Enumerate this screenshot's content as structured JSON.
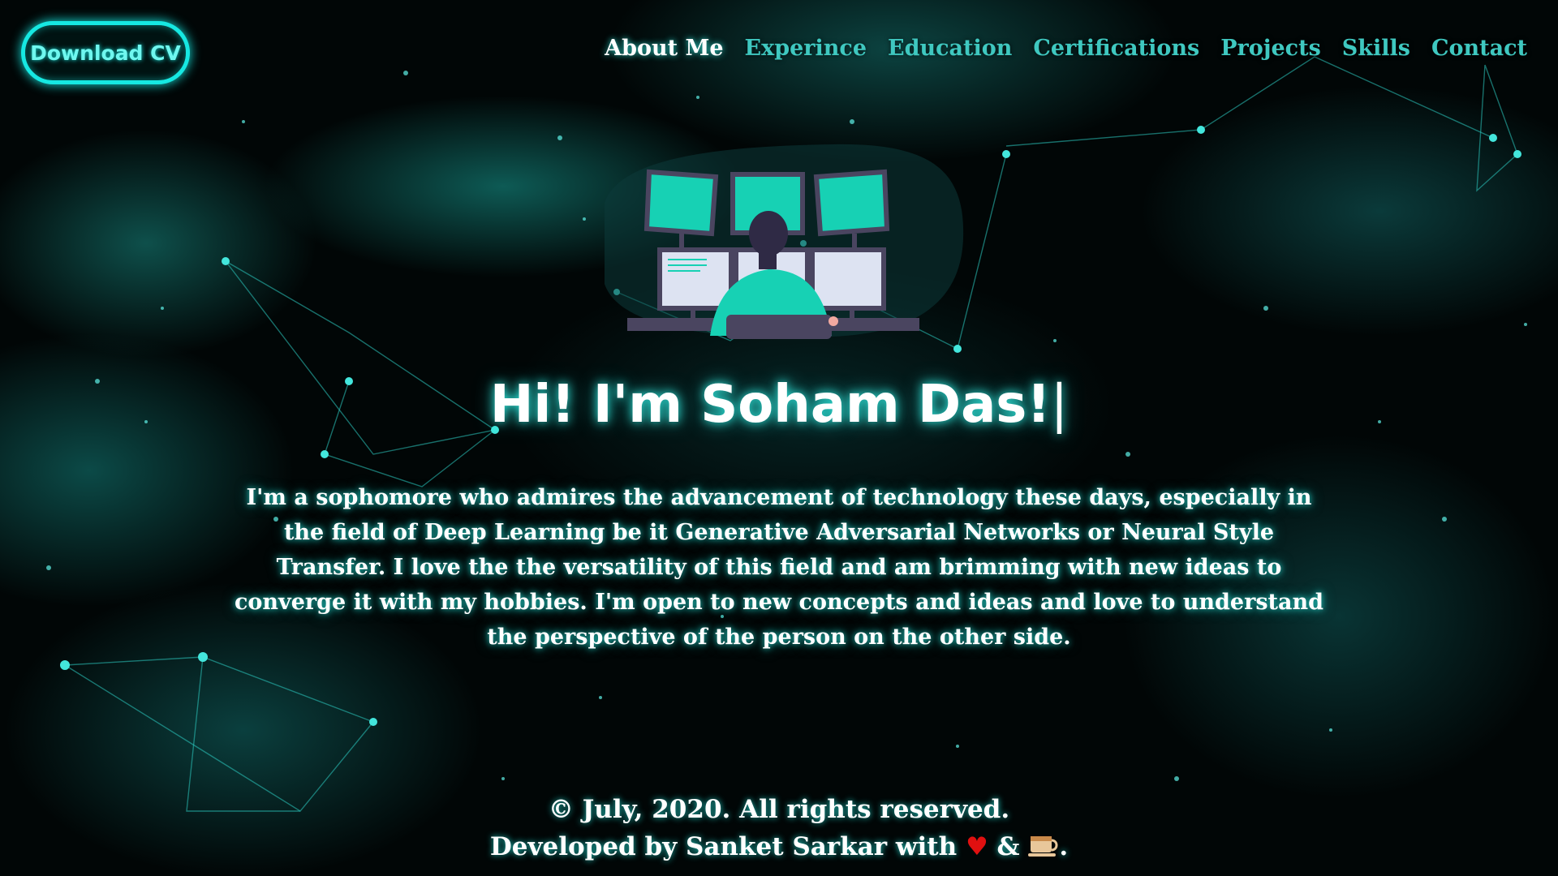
{
  "header": {
    "cv_button_label": "Download CV",
    "nav": [
      {
        "label": "About Me",
        "active": true
      },
      {
        "label": "Experince",
        "active": false
      },
      {
        "label": "Education",
        "active": false
      },
      {
        "label": "Certifications",
        "active": false
      },
      {
        "label": "Projects",
        "active": false
      },
      {
        "label": "Skills",
        "active": false
      },
      {
        "label": "Contact",
        "active": false
      }
    ]
  },
  "hero": {
    "title": "Hi! I'm Soham Das!",
    "caret": "|",
    "bio": "I'm a sophomore who admires the advancement of technology these days, especially in the field of Deep Learning be it Generative Adversarial Networks or Neural Style Transfer. I love the the versatility of this field and am brimming with new ideas to converge it with my hobbies. I'm open to new concepts and ideas and love to understand the perspective of the person on the other side."
  },
  "footer": {
    "copyright": "© July, 2020. All rights reserved.",
    "developed_prefix": "Developed by Sanket Sarkar with",
    "heart": "♥",
    "ampersand": "&",
    "period": ".",
    "icons": [
      "heart-icon",
      "coffee-icon"
    ]
  },
  "colors": {
    "accent": "#16e8e2",
    "nav_inactive": "#3fc8c0",
    "nav_active": "#ffffff",
    "background": "#010606",
    "heart": "#e01010"
  }
}
